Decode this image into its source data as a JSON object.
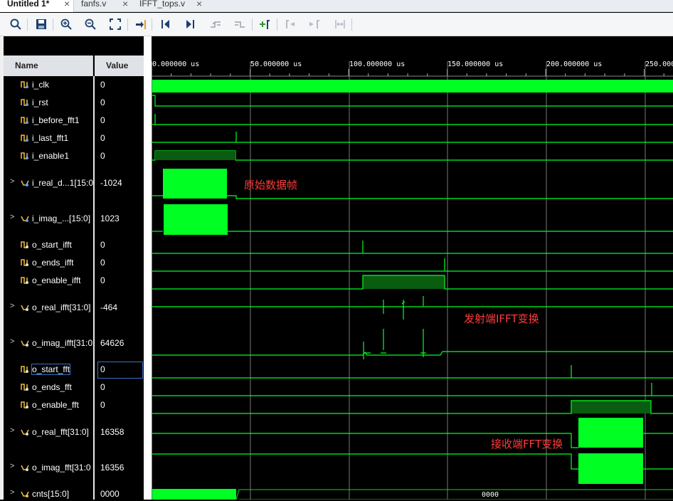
{
  "tabs": [
    {
      "label": "Untitled 1*",
      "active": true
    },
    {
      "label": "fanfs.v",
      "active": false
    },
    {
      "label": "IFFT_tops.v",
      "active": false
    }
  ],
  "toolbar": {
    "icons": [
      "zoom-search-icon",
      "save-icon",
      "zoom-in-icon",
      "zoom-out-icon",
      "zoom-fit-icon",
      "go-to-cursor-icon",
      "go-to-start-icon",
      "go-to-end-icon",
      "previous-transition-icon",
      "next-transition-icon",
      "add-marker-icon",
      "previous-marker-icon",
      "next-marker-icon",
      "swap-cursors-icon"
    ]
  },
  "columns": {
    "name": "Name",
    "value": "Value"
  },
  "timeline": {
    "ticks": [
      "0.000000 us",
      "50.000000 us",
      "100.000000 us",
      "150.000000 us",
      "200.000000 us",
      "250.000000 us"
    ]
  },
  "signals": [
    {
      "name": "i_clk",
      "value": "0",
      "type": "bit",
      "expandable": false
    },
    {
      "name": "i_rst",
      "value": "0",
      "type": "bit",
      "expandable": false
    },
    {
      "name": "i_before_fft1",
      "value": "0",
      "type": "bit",
      "expandable": false
    },
    {
      "name": "i_last_fft1",
      "value": "0",
      "type": "bit",
      "expandable": false
    },
    {
      "name": "i_enable1",
      "value": "0",
      "type": "bit",
      "expandable": false
    },
    {
      "name": "i_real_d...1[15:0",
      "value": "-1024",
      "type": "bus",
      "expandable": true
    },
    {
      "name": "i_imag_...[15:0]",
      "value": "1023",
      "type": "bus",
      "expandable": true
    },
    {
      "name": "o_start_ifft",
      "value": "0",
      "type": "bit",
      "expandable": false
    },
    {
      "name": "o_ends_ifft",
      "value": "0",
      "type": "bit",
      "expandable": false
    },
    {
      "name": "o_enable_ifft",
      "value": "0",
      "type": "bit",
      "expandable": false
    },
    {
      "name": "o_real_ifft[31:0]",
      "value": "-464",
      "type": "bus",
      "expandable": true
    },
    {
      "name": "o_imag_ifft[31:0",
      "value": "64626",
      "type": "bus",
      "expandable": true
    },
    {
      "name": "o_start_fft",
      "value": "0",
      "type": "bit",
      "expandable": false
    },
    {
      "name": "o_ends_fft",
      "value": "0",
      "type": "bit",
      "expandable": false
    },
    {
      "name": "o_enable_fft",
      "value": "0",
      "type": "bit",
      "expandable": false
    },
    {
      "name": "o_real_fft[31:0]",
      "value": "16358",
      "type": "bus",
      "expandable": true
    },
    {
      "name": "o_imag_fft[31:0",
      "value": "16356",
      "type": "bus",
      "expandable": true
    },
    {
      "name": "cnts[15:0]",
      "value": "0000",
      "type": "bus",
      "expandable": true
    }
  ],
  "annotations": [
    "原始数据帧",
    "发射端IFFT变换",
    "接收端FFT变换"
  ],
  "bus_label": "0000",
  "colors": {
    "wave": "#00ff22",
    "wave_dim": "#00aa22",
    "annotation": "#ff3b3b",
    "selection": "#3b6fc6"
  }
}
